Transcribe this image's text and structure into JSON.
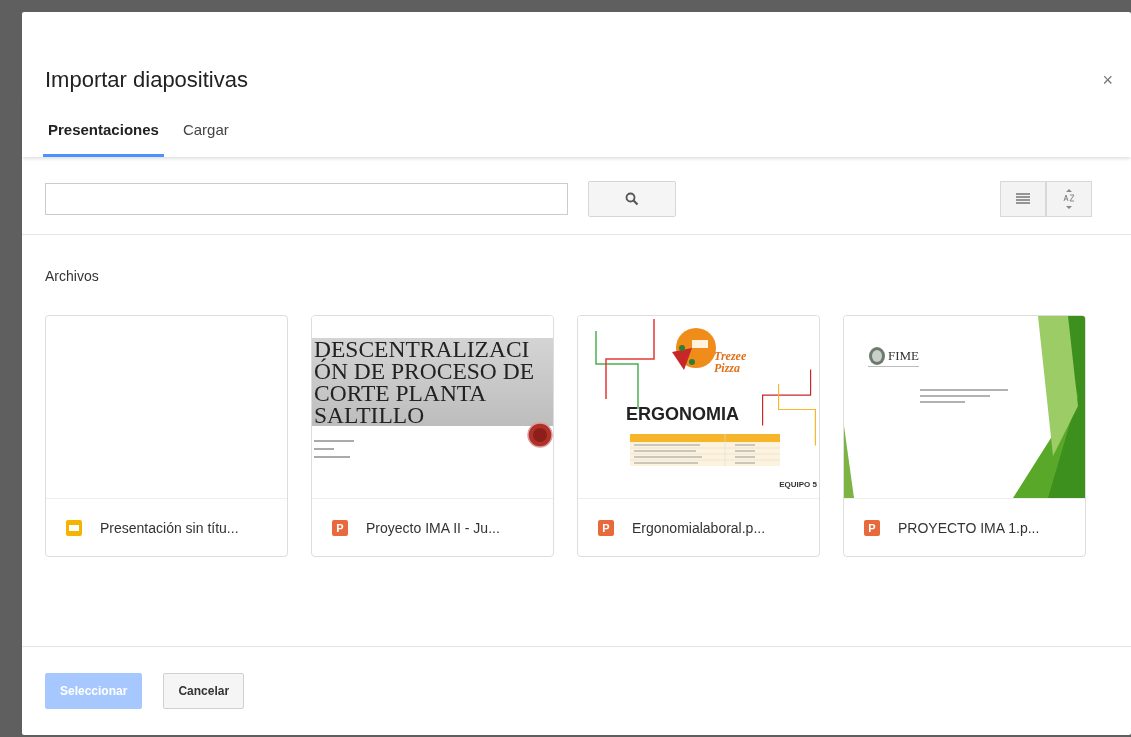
{
  "dialog": {
    "title": "Importar diapositivas",
    "close": "×"
  },
  "tabs": [
    {
      "label": "Presentaciones",
      "selected": true
    },
    {
      "label": "Cargar",
      "selected": false
    }
  ],
  "section_label": "Archivos",
  "files": [
    {
      "name": "Presentación sin títu...",
      "icon": {
        "kind": "slides"
      },
      "thumbnail": {
        "kind": "none"
      }
    },
    {
      "name": "Proyecto IMA II - Ju...",
      "icon": {
        "kind": "powerpoint",
        "letter": "P"
      },
      "thumbnail": {
        "kind": "gray-title",
        "lines": [
          "DESCENTRALIZACI",
          "ÓN DE PROCESO DE",
          "CORTE PLANTA",
          "SALTILLO"
        ]
      }
    },
    {
      "name": "Ergonomialaboral.p...",
      "icon": {
        "kind": "powerpoint",
        "letter": "P"
      },
      "thumbnail": {
        "kind": "pizza",
        "logo": [
          "Trezee",
          "Pizza"
        ],
        "title": "ERGONOMIA",
        "footer": "EQUIPO 5"
      }
    },
    {
      "name": "PROYECTO IMA 1.p...",
      "icon": {
        "kind": "powerpoint",
        "letter": "P"
      },
      "thumbnail": {
        "kind": "green",
        "logo": "FIME"
      }
    }
  ],
  "buttons": [
    {
      "label": "Seleccionar",
      "kind": "primary",
      "disabled": true
    },
    {
      "label": "Cancelar",
      "kind": "secondary",
      "disabled": false
    }
  ]
}
